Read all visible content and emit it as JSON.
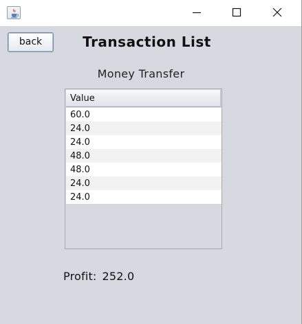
{
  "window": {
    "icon": "java-cup-icon",
    "controls": {
      "minimize": "minimize-icon",
      "maximize": "maximize-icon",
      "close": "close-icon"
    }
  },
  "header": {
    "back_label": "back",
    "title": "Transaction List"
  },
  "table": {
    "caption": "Money Transfer",
    "column_header": "Value",
    "rows": [
      "60.0",
      "24.0",
      "24.0",
      "48.0",
      "48.0",
      "24.0",
      "24.0"
    ]
  },
  "summary": {
    "profit_label": "Profit:",
    "profit_value": "252.0"
  }
}
